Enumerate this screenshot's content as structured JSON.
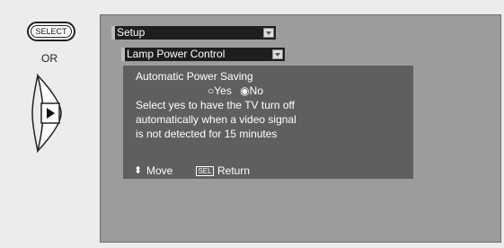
{
  "remote": {
    "select_label": "SELECT",
    "or_label": "OR",
    "select_icon": "select-button-icon",
    "dpad_icon": "right-arrow-pad-icon"
  },
  "menu": {
    "setup_label": "Setup",
    "submenu_label": "Lamp Power Control"
  },
  "panel": {
    "heading": "Automatic Power Saving",
    "options": [
      {
        "label": "Yes",
        "symbol": "○",
        "selected": false
      },
      {
        "label": "No",
        "symbol": "◉",
        "selected": true
      }
    ],
    "description": [
      "Select yes to have the TV turn off",
      "automatically when a video signal",
      "is not detected for 15 minutes"
    ]
  },
  "footer": {
    "move_symbol": "⬍",
    "move_label": "Move",
    "sel_key": "SEL",
    "return_label": "Return"
  },
  "colors": {
    "screen_bg": "#9c9c9c",
    "panel_bg": "#5f5f5f",
    "tab_bg": "#1e1e1e"
  }
}
